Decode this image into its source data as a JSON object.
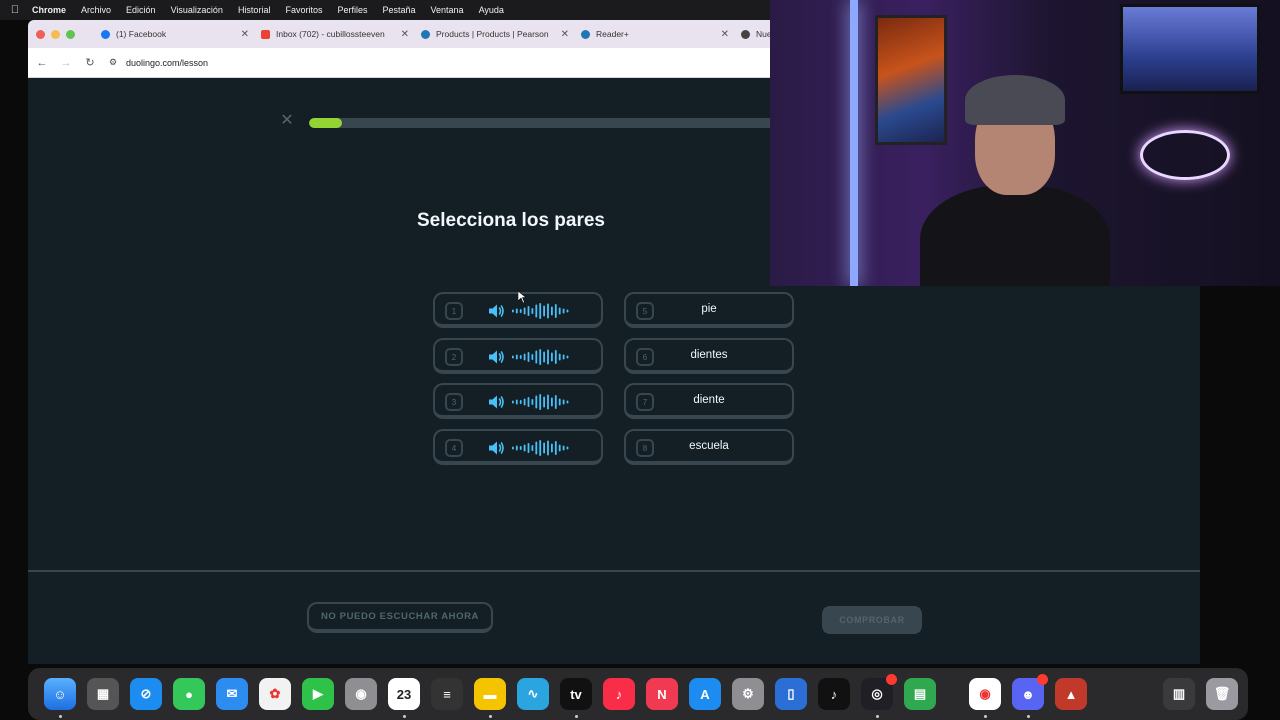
{
  "menubar": {
    "items": [
      "Chrome",
      "Archivo",
      "Edición",
      "Visualización",
      "Historial",
      "Favoritos",
      "Perfiles",
      "Pestaña",
      "Ventana",
      "Ayuda"
    ]
  },
  "browser": {
    "tabs": [
      {
        "title": "(1) Facebook",
        "icon": "facebook-icon"
      },
      {
        "title": "Inbox (702) - cubillossteeven",
        "icon": "gmail-icon"
      },
      {
        "title": "Products | Products | Pearson",
        "icon": "pearson-icon"
      },
      {
        "title": "Reader+",
        "icon": "pearson-icon"
      },
      {
        "title": "Nueva",
        "icon": "chrome-icon"
      }
    ],
    "url": "duolingo.com/lesson"
  },
  "lesson": {
    "progress": 0.07,
    "title": "Selecciona los pares",
    "left_cards": [
      {
        "num": "1"
      },
      {
        "num": "2"
      },
      {
        "num": "3"
      },
      {
        "num": "4"
      }
    ],
    "right_cards": [
      {
        "num": "5",
        "word": "pie"
      },
      {
        "num": "6",
        "word": "dientes"
      },
      {
        "num": "7",
        "word": "diente"
      },
      {
        "num": "8",
        "word": "escuela"
      }
    ],
    "cant_listen_label": "NO PUEDO ESCUCHAR AHORA",
    "check_label": "COMPROBAR"
  },
  "colors": {
    "background": "#131f24",
    "card_border": "#37464f",
    "progress_fill": "#93d333",
    "audio_blue": "#49c0f8"
  },
  "dock": {
    "calendar_day": "23"
  }
}
